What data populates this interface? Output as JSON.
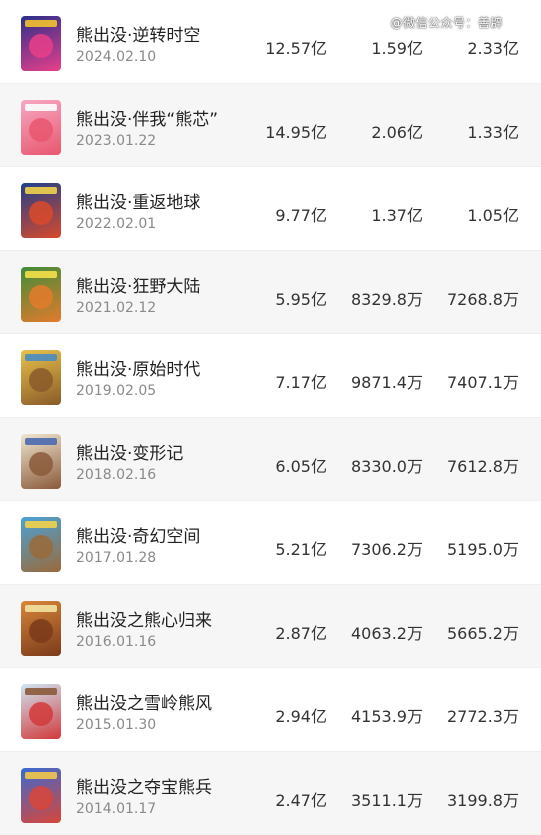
{
  "watermark": "@微信公众号：善辟",
  "colors": {
    "row_shade": "#f6f6f6",
    "title_text": "#222222",
    "date_text": "#8a8a8a"
  },
  "movies": [
    {
      "title": "熊出没·逆转时空",
      "date": "2024.02.10",
      "v1": "12.57亿",
      "v2": "1.59亿",
      "v3": "2.33亿",
      "poster_colors": [
        "#2a2f8a",
        "#e83f8a",
        "#f2c12e"
      ]
    },
    {
      "title": "熊出没·伴我“熊芯”",
      "date": "2023.01.22",
      "v1": "14.95亿",
      "v2": "2.06亿",
      "v3": "1.33亿",
      "poster_colors": [
        "#f7a8c4",
        "#e8576e",
        "#ffffff"
      ]
    },
    {
      "title": "熊出没·重返地球",
      "date": "2022.02.01",
      "v1": "9.77亿",
      "v2": "1.37亿",
      "v3": "1.05亿",
      "poster_colors": [
        "#1e3f8c",
        "#d94a2a",
        "#f0d24a"
      ]
    },
    {
      "title": "熊出没·狂野大陆",
      "date": "2021.02.12",
      "v1": "5.95亿",
      "v2": "8329.8万",
      "v3": "7268.8万",
      "poster_colors": [
        "#3f8c3a",
        "#e37b2c",
        "#f5e04a"
      ]
    },
    {
      "title": "熊出没·原始时代",
      "date": "2019.02.05",
      "v1": "7.17亿",
      "v2": "9871.4万",
      "v3": "7407.1万",
      "poster_colors": [
        "#e8c24a",
        "#8a5a2a",
        "#4a8cc2"
      ]
    },
    {
      "title": "熊出没·变形记",
      "date": "2018.02.16",
      "v1": "6.05亿",
      "v2": "8330.0万",
      "v3": "7612.8万",
      "poster_colors": [
        "#f0e6d2",
        "#8a5a3a",
        "#4a6ab0"
      ]
    },
    {
      "title": "熊出没·奇幻空间",
      "date": "2017.01.28",
      "v1": "5.21亿",
      "v2": "7306.2万",
      "v3": "5195.0万",
      "poster_colors": [
        "#4aa2d8",
        "#9a6a3a",
        "#f2d24a"
      ]
    },
    {
      "title": "熊出没之熊心归来",
      "date": "2016.01.16",
      "v1": "2.87亿",
      "v2": "4063.2万",
      "v3": "5665.2万",
      "poster_colors": [
        "#d8863a",
        "#7a3a1a",
        "#f2e2a0"
      ]
    },
    {
      "title": "熊出没之雪岭熊风",
      "date": "2015.01.30",
      "v1": "2.94亿",
      "v2": "4153.9万",
      "v3": "2772.3万",
      "poster_colors": [
        "#cfe6f5",
        "#d23a3a",
        "#8a5a3a"
      ]
    },
    {
      "title": "熊出没之夺宝熊兵",
      "date": "2014.01.17",
      "v1": "2.47亿",
      "v2": "3511.1万",
      "v3": "3199.8万",
      "poster_colors": [
        "#3a6ad2",
        "#d8463a",
        "#f2c84a"
      ]
    }
  ]
}
